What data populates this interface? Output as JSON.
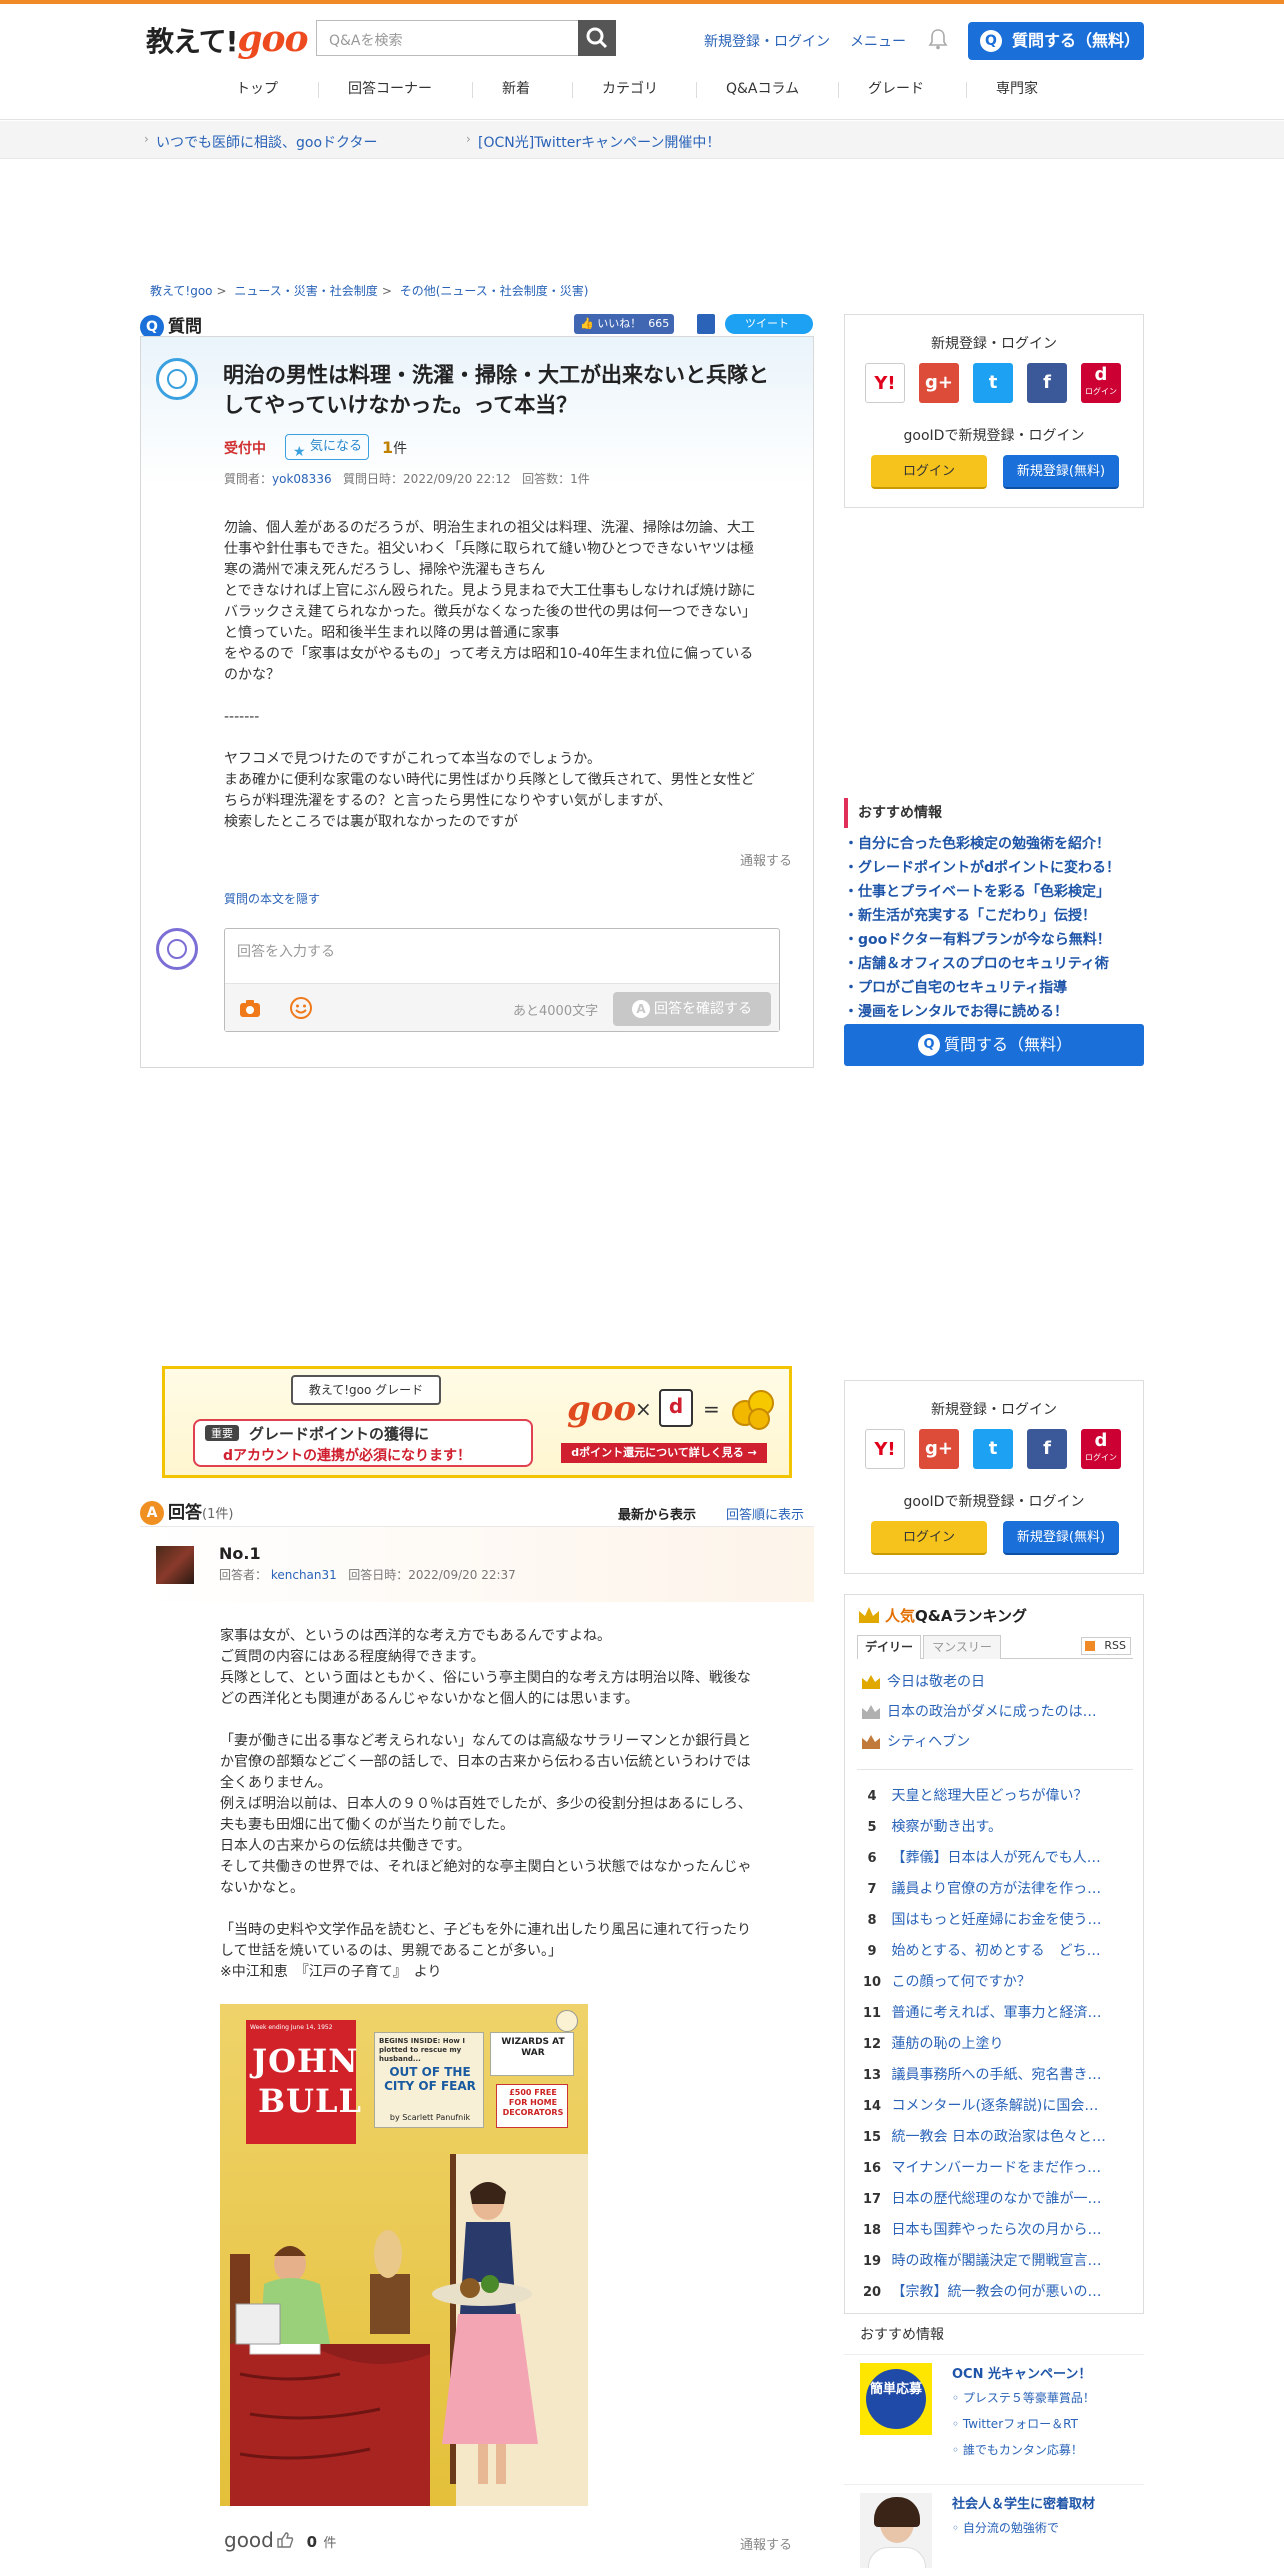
{
  "header": {
    "logo_text": "教えて!",
    "logo_brand": "goo",
    "search_placeholder": "Q&Aを検索",
    "login_link": "新規登録・ログイン",
    "menu_link": "メニュー",
    "ask_button": "質問する（無料）"
  },
  "nav": [
    "トップ",
    "回答コーナー",
    "新着",
    "カテゴリ",
    "Q&Aコラム",
    "グレード",
    "専門家"
  ],
  "promos": [
    "いつでも医師に相談、gooドクター",
    "[OCN光]Twitterキャンペーン開催中！"
  ],
  "breadcrumb": [
    "教えて!goo",
    "ニュース・災害・社会制度",
    "その他(ニュース・社会制度・災害)"
  ],
  "question": {
    "section_label": "質問",
    "like_label": "いいね！",
    "like_count": "665",
    "tweet_label": "ツイート",
    "title": "明治の男性は料理・洗濯・掃除・大工が出来ないと兵隊としてやっていけなかった。って本当？",
    "status": "受付中",
    "follow_label": "気になる",
    "follow_count": "1",
    "follow_unit": "件",
    "meta_asker_label": "質問者：",
    "asker": "yok08336",
    "meta_date": "質問日時：2022/09/20 22:12",
    "meta_answers": "回答数：1件",
    "body": "勿論、個人差があるのだろうが、明治生まれの祖父は料理、洗濯、掃除は勿論、大工\n仕事や針仕事もできた。祖父いわく「兵隊に取られて縫い物ひとつできないヤツは極\n寒の満州で凍え死んだろうし、掃除や洗濯もきちん\nとできなければ上官にぶん殴られた。見よう見まねで大工仕事もしなければ焼け跡に\nバラックさえ建てられなかった。徴兵がなくなった後の世代の男は何一つできない」\nと憤っていた。昭和後半生まれ以降の男は普通に家事\nをやるので「家事は女がやるもの」って考え方は昭和10-40年生まれ位に偏っている\nのかな？\n\n-------\n\nヤフコメで見つけたのですがこれって本当なのでしょうか。\nまあ確かに便利な家電のない時代に男性ばかり兵隊として徴兵されて、男性と女性ど\nちらが料理洗濯をするの？と言ったら男性になりやすい気がしますが、\n検索したところでは裏が取れなかったのですが",
    "report": "通報する",
    "quote_link": "質問の本文を隠す",
    "answer_placeholder": "回答を入力する",
    "char_remaining": "あと4000文字",
    "confirm_button": "回答を確認する"
  },
  "sidebar": {
    "register_title": "新規登録・ログイン",
    "gooid_text": "gooIDで新規登録・ログイン",
    "login_button": "ログイン",
    "register_button": "新規登録(無料)",
    "sns": [
      {
        "name": "yahoo-icon",
        "glyph": "Y!",
        "color": "#ffffff",
        "fg": "#e0001c"
      },
      {
        "name": "google-plus-icon",
        "glyph": "g+",
        "color": "#dd4b39",
        "fg": "#ffffff"
      },
      {
        "name": "twitter-icon",
        "glyph": "t",
        "color": "#1da1f2",
        "fg": "#ffffff"
      },
      {
        "name": "facebook-icon",
        "glyph": "f",
        "color": "#3b5998",
        "fg": "#ffffff"
      },
      {
        "name": "docomo-icon",
        "glyph": "d",
        "color": "#cc0033",
        "fg": "#ffffff"
      }
    ],
    "docomo_label": "ログイン",
    "recommend_title": "おすすめ情報",
    "recommend": [
      "自分に合った色彩検定の勉強術を紹介！",
      "グレードポイントがdポイントに変わる！",
      "仕事とプライベートを彩る「色彩検定」",
      "新生活が充実する「こだわり」伝授！",
      "gooドクター有料プランが今なら無料！",
      "店舗＆オフィスのプロのセキュリティ術",
      "プロがご自宅のセキュリティ指導",
      "漫画をレンタルでお得に読める！"
    ],
    "ask_button": "質問する（無料）"
  },
  "banner": {
    "badge": "教えて!goo グレード",
    "important": "重要",
    "line1": "グレードポイントの獲得に",
    "line2": "dアカウントの連携が必須になります！",
    "goo": "goo",
    "times": "×",
    "equals": "=",
    "link": "dポイント還元について詳しく見る →"
  },
  "answers": {
    "section_label": "回答",
    "count": "(1件)",
    "sort_new": "最新から表示",
    "sort_old": "回答順に表示",
    "items": [
      {
        "no": "No.1",
        "meta_answerer_label": "回答者：",
        "answerer": "kenchan31",
        "date": "回答日時：2022/09/20 22:37",
        "body": "家事は女が、というのは西洋的な考え方でもあるんですよね。\nご質問の内容にはある程度納得できます。\n兵隊として、という面はともかく、俗にいう亭主関白的な考え方は明治以降、戦後な\nどの西洋化とも関連があるんじゃないかなと個人的には思います。\n\n「妻が働きに出る事など考えられない」なんてのは高級なサラリーマンとか銀行員と\nか官僚の部類などごく一部の話しで、日本の古来から伝わる古い伝統というわけでは\n全くありません。\n例えば明治以前は、日本人の９０％は百姓でしたが、多少の役割分担はあるにしろ、\n夫も妻も田畑に出て働くのが当たり前でした。\n日本人の古来からの伝統は共働きです。\nそして共働きの世界では、それほど絶対的な亭主関白という状態ではなかったんじゃ\nないかなと。\n\n「当時の史料や文学作品を読むと、子どもを外に連れ出したり風呂に連れて行ったり\nして世話を焼いているのは、男親であることが多い。」\n※中江和恵　『江戸の子育て』　より",
        "magazine": {
          "top_line": "Week ending June 14, 1952",
          "title1": "JOHN",
          "title2": "BULL",
          "inside": "BEGINS INSIDE: How I plotted to rescue my husband...",
          "story": "OUT OF THE CITY OF FEAR",
          "author": "by Scarlett Panufnik",
          "wizards": "WIZARDS AT WAR",
          "prize": "£500 FREE FOR HOME DECORATORS"
        },
        "good_label": "good",
        "good_count": "0",
        "good_unit": "件",
        "report": "通報する"
      }
    ]
  },
  "ranking": {
    "title_accent": "人気",
    "title_rest": "Q&Aランキング",
    "tab_daily": "デイリー",
    "tab_monthly": "マンスリー",
    "rss": "RSS",
    "top3": [
      {
        "title": "今日は敬老の日",
        "crown": "#e0a800"
      },
      {
        "title": "日本の政治がダメに成ったのは…",
        "crown": "#b0b0b0"
      },
      {
        "title": "シティヘブン",
        "crown": "#c27a3a"
      }
    ],
    "items": [
      {
        "rank": "4",
        "title": "天皇と総理大臣どっちが偉い？"
      },
      {
        "rank": "5",
        "title": "検察が動き出す。"
      },
      {
        "rank": "6",
        "title": "【葬儀】日本は人が死んでも人…"
      },
      {
        "rank": "7",
        "title": "議員より官僚の方が法律を作っ…"
      },
      {
        "rank": "8",
        "title": "国はもっと妊産婦にお金を使う…"
      },
      {
        "rank": "9",
        "title": "始めとする、初めとする　どち…"
      },
      {
        "rank": "10",
        "title": "この顔って何ですか？"
      },
      {
        "rank": "11",
        "title": "普通に考えれば、軍事力と経済…"
      },
      {
        "rank": "12",
        "title": "蓮舫の恥の上塗り"
      },
      {
        "rank": "13",
        "title": "議員事務所への手紙、宛名書き…"
      },
      {
        "rank": "14",
        "title": "コメンタール(逐条解説)に国会…"
      },
      {
        "rank": "15",
        "title": "統一教会 日本の政治家は色々と…"
      },
      {
        "rank": "16",
        "title": "マイナンバーカードをまだ作っ…"
      },
      {
        "rank": "17",
        "title": "日本の歴代総理のなかで誰が一…"
      },
      {
        "rank": "18",
        "title": "日本も国葬やったら次の月から…"
      },
      {
        "rank": "19",
        "title": "時の政権が閣議決定で開戦宣言…"
      },
      {
        "rank": "20",
        "title": "【宗教】統一教会の何が悪いの…"
      }
    ]
  },
  "osusume2": {
    "title": "おすすめ情報",
    "promos": [
      {
        "badge": "簡単応募",
        "title": "OCN 光キャンペーン！",
        "links": [
          "プレステ５等豪華賞品！",
          "Twitterフォロー＆RT",
          "誰でもカンタン応募！"
        ]
      },
      {
        "title": "社会人＆学生に密着取材",
        "links": [
          "自分流の勉強術で"
        ]
      }
    ]
  }
}
